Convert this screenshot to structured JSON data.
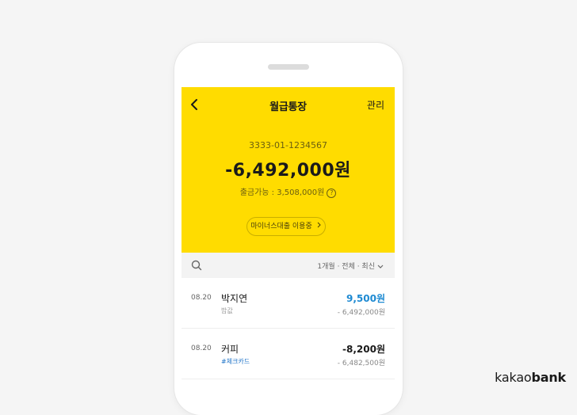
{
  "header": {
    "title": "월급통장",
    "manage_label": "관리"
  },
  "account": {
    "number": "3333-01-1234567",
    "balance": "-6,492,000원",
    "available": "출금가능 : 3,508,000원",
    "help_glyph": "?",
    "minus_loan_label": "마이너스대출 이용중"
  },
  "filter": {
    "label": "1개월 · 전체 · 최신"
  },
  "transactions": [
    {
      "date": "08.20",
      "name": "박지연",
      "memo": "밥값",
      "amount": "9,500원",
      "balance_after": "- 6,492,000원"
    },
    {
      "date": "08.20",
      "name": "커피",
      "memo": "#체크카드",
      "amount": "-8,200원",
      "balance_after": "- 6,482,500원"
    }
  ],
  "brand": {
    "prefix": "kakao",
    "suffix": "bank"
  },
  "colors": {
    "accent": "#ffdc00",
    "deposit": "#1e8ad2",
    "tag": "#1e73c8"
  },
  "icons": [
    "back-arrow-icon",
    "help-icon",
    "chevron-right-icon",
    "search-icon",
    "chevron-down-icon"
  ]
}
